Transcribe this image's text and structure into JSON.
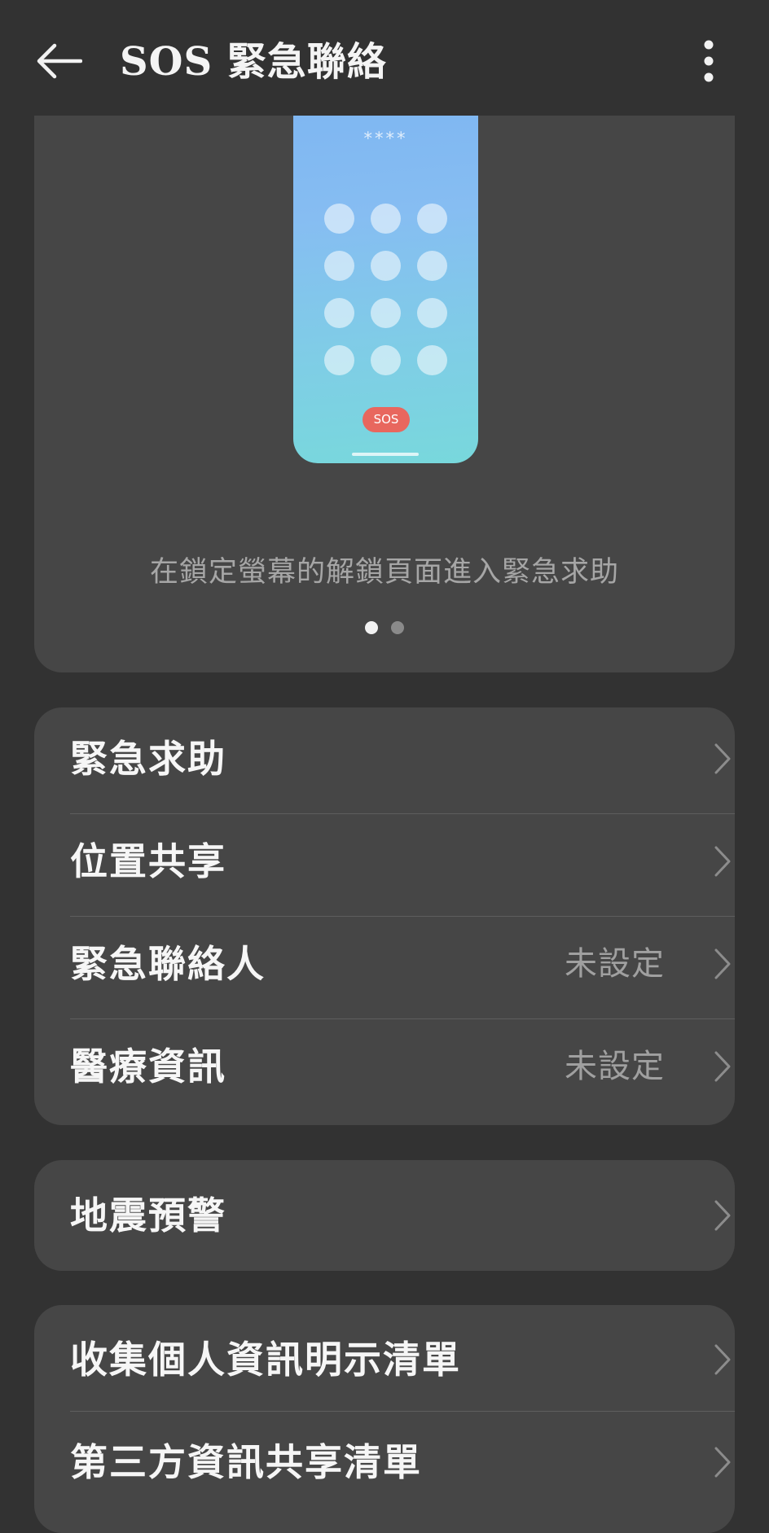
{
  "header": {
    "title": "SOS 緊急聯絡",
    "back_icon": "arrow-left-icon",
    "more_icon": "more-vertical-icon"
  },
  "hero": {
    "pin_mask": "****",
    "sos_label": "SOS",
    "caption": "在鎖定螢幕的解鎖頁面進入緊急求助",
    "pager": {
      "pages": 2,
      "active": 1
    },
    "colors": {
      "gradient_top": "#7db5f2",
      "gradient_bottom": "#78d8dc",
      "sos": "#e8675e"
    }
  },
  "emergency_group": {
    "items": [
      {
        "label": "緊急求助",
        "value": ""
      },
      {
        "label": "位置共享",
        "value": ""
      },
      {
        "label": "緊急聯絡人",
        "value": "未設定"
      },
      {
        "label": "醫療資訊",
        "value": "未設定"
      }
    ]
  },
  "earthquake_group": {
    "items": [
      {
        "label": "地震預警"
      }
    ]
  },
  "privacy_group": {
    "items": [
      {
        "label": "收集個人資訊明示清單"
      },
      {
        "label": "第三方資訊共享清單"
      }
    ]
  },
  "chevron_icon": "chevron-right-icon"
}
